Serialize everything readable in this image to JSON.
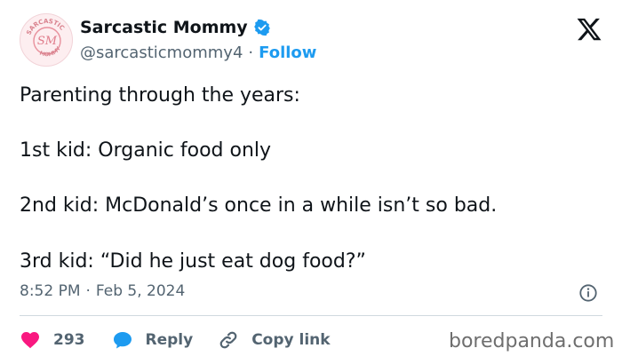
{
  "author": {
    "display_name": "Sarcastic Mommy",
    "handle": "@sarcasticmommy4",
    "separator": "·",
    "follow_label": "Follow",
    "avatar_text": "SM",
    "avatar_ring_text": "SARCASTIC MOMMY"
  },
  "tweet": {
    "lines": [
      "Parenting through the years:",
      "1st kid: Organic food only",
      "2nd kid: McDonald’s once in a while isn’t so bad.",
      "3rd kid: “Did he just eat dog food?”"
    ],
    "time": "8:52 PM",
    "meta_separator": "·",
    "date": "Feb 5, 2024"
  },
  "actions": {
    "likes_count": "293",
    "reply_label": "Reply",
    "copy_link_label": "Copy link"
  },
  "watermark": "boredpanda.com",
  "icons": {
    "verified": "verified-badge-icon",
    "x_logo": "x-logo-icon",
    "info": "info-icon",
    "heart": "heart-icon",
    "reply": "speech-bubble-icon",
    "link": "link-icon"
  },
  "colors": {
    "accent": "#1d9bf0",
    "heart": "#f91880",
    "text": "#0f1419",
    "muted": "#536471",
    "avatar_pink": "#e8909c"
  }
}
